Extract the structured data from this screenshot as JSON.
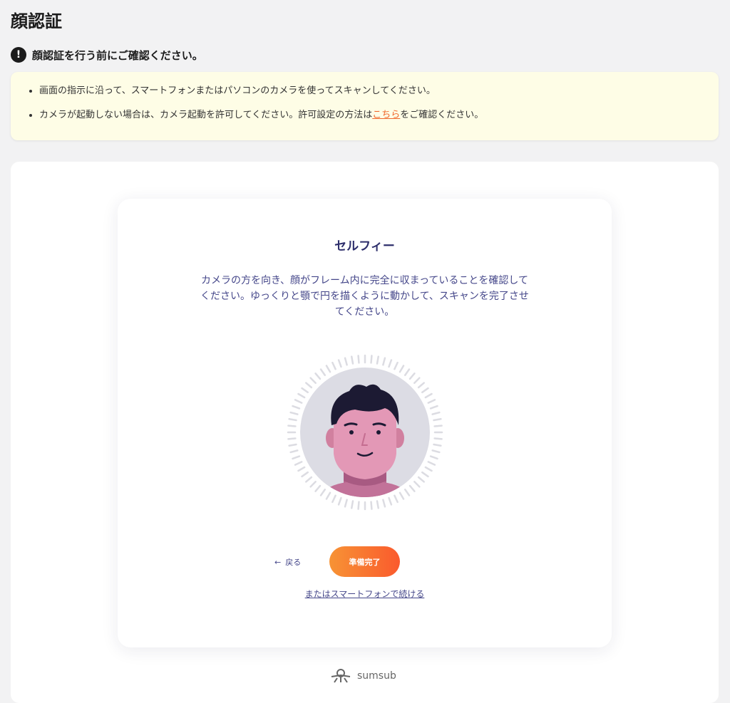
{
  "page": {
    "title": "顔認証"
  },
  "notice": {
    "heading": "顔認証を行う前にご確認ください。",
    "items": [
      {
        "text": "画面の指示に沿って、スマートフォンまたはパソコンのカメラを使ってスキャンしてください。"
      },
      {
        "text_before": "カメラが起動しない場合は、カメラ起動を許可してください。許可設定の方法は",
        "link": "こちら",
        "text_after": "をご確認ください。"
      }
    ]
  },
  "selfie": {
    "title": "セルフィー",
    "description": "カメラの方を向き、顔がフレーム内に完全に収まっていることを確認してください。ゆっくりと顎で円を描くように動かして、スキャンを完了させてください。",
    "back_label": "戻る",
    "ready_label": "準備完了",
    "phone_link": "またはスマートフォンで続ける"
  },
  "brand": {
    "name": "sumsub"
  },
  "colors": {
    "accent": "#f0672a",
    "button_start": "#f79335",
    "button_end": "#fa5a2d",
    "text_primary": "#2d2e6b",
    "notice_bg": "#fefde6"
  },
  "icons": {
    "alert": "exclamation-circle-icon",
    "back": "arrow-left-icon",
    "brand": "sumsub-logo-icon",
    "avatar": "face-illustration"
  }
}
